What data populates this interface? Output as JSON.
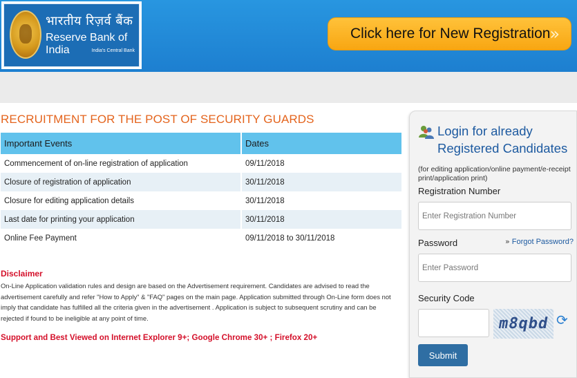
{
  "header": {
    "logo": {
      "hindi": "भारतीय रिज़र्व बैंक",
      "english": "Reserve Bank of India",
      "tagline": "India's Central Bank"
    },
    "new_registration_label": "Click here for New Registration",
    "arrow_icon": "double-chevron-right-icon"
  },
  "main": {
    "title": "RECRUITMENT FOR THE POST OF SECURITY GUARDS",
    "table": {
      "headers": [
        "Important Events",
        "Dates"
      ],
      "rows": [
        [
          "Commencement of on-line registration of application",
          "09/11/2018"
        ],
        [
          "Closure of registration of application",
          "30/11/2018"
        ],
        [
          "Closure for editing application details",
          "30/11/2018"
        ],
        [
          "Last date for printing your application",
          "30/11/2018"
        ],
        [
          "Online Fee Payment",
          "09/11/2018 to 30/11/2018"
        ]
      ]
    },
    "disclaimer_title": "Disclaimer",
    "disclaimer_text": "On-Line Application validation rules and design are based on the Advertisement requirement. Candidates are advised to read the advertisement carefully and refer \"How to Apply\" & \"FAQ\" pages on the main page. Application submitted through On-Line form does not imply that candidate has fulfilled all the criteria given in the advertisement . Application is subject to subsequent scrutiny and can be rejected if found to be ineligible at any point of time.",
    "support_text": "Support and Best Viewed on Internet Explorer 9+; Google Chrome 30+ ; Firefox 20+"
  },
  "login": {
    "title_line1": "Login for already",
    "title_line2": "Registered Candidates",
    "note": "(for editing application/online payment/e-receipt print/application print)",
    "reg_label": "Registration Number",
    "reg_placeholder": "Enter Registration Number",
    "password_label": "Password",
    "forgot_label": "Forgot Password?",
    "password_placeholder": "Enter Password",
    "security_label": "Security Code",
    "captcha_text": "m8qbd",
    "submit_label": "Submit"
  },
  "colors": {
    "header_blue": "#1d7fd0",
    "accent_orange": "#e4641d",
    "button_yellow": "#f8a612",
    "table_header": "#61c2ec",
    "warning_red": "#d4102a",
    "login_blue": "#1d5aa0"
  }
}
